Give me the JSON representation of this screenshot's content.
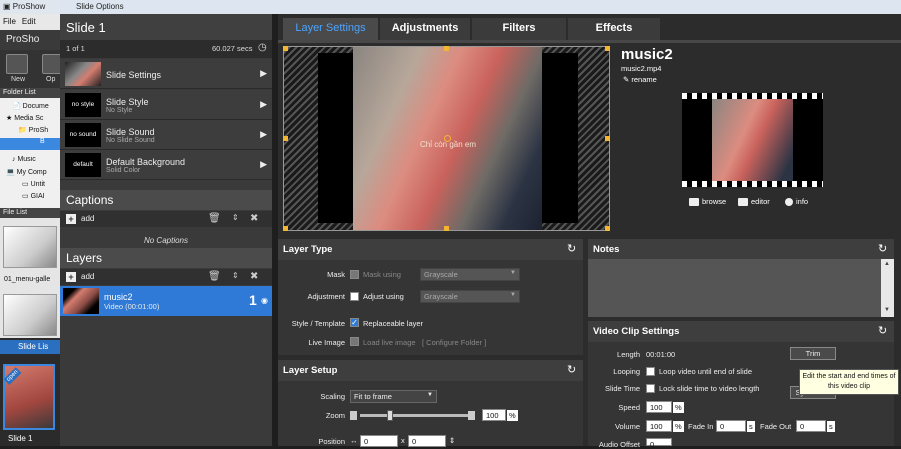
{
  "bgapp": {
    "title": "ProShow",
    "menu": [
      "File",
      "Edit"
    ],
    "brand": "ProSho",
    "tools": [
      {
        "label": "New"
      },
      {
        "label": "Op"
      }
    ],
    "folder_header": "Folder List",
    "tree": [
      "Docume",
      "Media Sc",
      "ProSh",
      "B",
      "Music",
      "My Comp",
      "Untit",
      "GIAI"
    ],
    "file_header": "File List",
    "file_item": "01_menu-galle",
    "slide_list_label": "Slide Lis",
    "open_badge": "open",
    "slide_label": "Slide 1"
  },
  "dialog": {
    "title": "Slide Options"
  },
  "left": {
    "slide_title": "Slide 1",
    "slide_index": "1 of 1",
    "duration": "60.027 secs",
    "rows": [
      {
        "thumb": "",
        "title": "Slide Settings",
        "sub": ""
      },
      {
        "thumb": "no style",
        "title": "Slide Style",
        "sub": "No Style"
      },
      {
        "thumb": "no sound",
        "title": "Slide Sound",
        "sub": "No Slide Sound"
      },
      {
        "thumb": "default",
        "title": "Default Background",
        "sub": "Solid Color"
      }
    ],
    "captions_header": "Captions",
    "add_label": "add",
    "no_captions": "No Captions",
    "layers_header": "Layers",
    "layer": {
      "name": "music2",
      "sub": "Video (00:01:00)",
      "number": "1"
    }
  },
  "tabs": [
    {
      "label": "Layer Settings",
      "active": true
    },
    {
      "label": "Adjustments",
      "active": false
    },
    {
      "label": "Filters",
      "active": false
    },
    {
      "label": "Effects",
      "active": false
    }
  ],
  "preview": {
    "watermark": "Chỉ còn gần em"
  },
  "right": {
    "title": "music2",
    "filename": "music2.mp4",
    "rename": "rename",
    "browse": "browse",
    "editor": "editor",
    "info": "info"
  },
  "layer_type": {
    "header": "Layer Type",
    "mask_label": "Mask",
    "mask_using": "Mask using",
    "mask_select": "Grayscale",
    "adj_label": "Adjustment",
    "adj_using": "Adjust using",
    "adj_select": "Grayscale",
    "style_label": "Style / Template",
    "replaceable": "Replaceable layer",
    "live_label": "Live Image",
    "load_live": "Load live image",
    "configure": "[ Configure Folder ]"
  },
  "layer_setup": {
    "header": "Layer Setup",
    "scaling_label": "Scaling",
    "scaling_value": "Fit to frame",
    "zoom_label": "Zoom",
    "zoom_value": "100",
    "zoom_unit": "%",
    "zoom_level": 0.28,
    "position_label": "Position",
    "pos_x": "0",
    "pos_x_sep": "x",
    "pos_y": "0"
  },
  "notes": {
    "header": "Notes"
  },
  "video": {
    "header": "Video Clip Settings",
    "length_label": "Length",
    "length_value": "00:01:00",
    "trim": "Trim",
    "looping_label": "Looping",
    "looping_text": "Loop video until end of slide",
    "slidetime_label": "Slide Time",
    "slidetime_text": "Lock slide time to video length",
    "sync": "Sync Time",
    "speed_label": "Speed",
    "speed_value": "100",
    "speed_unit": "%",
    "volume_label": "Volume",
    "volume_value": "100",
    "volume_unit": "%",
    "fadein_label": "Fade In",
    "fadein_value": "0",
    "fadeout_label": "Fade Out",
    "fadeout_value": "0",
    "s_unit": "s",
    "audio_offset_label": "Audio Offset",
    "audio_offset_value": "0",
    "tooltip": "Edit the start and end times of this video clip"
  },
  "colors": {
    "accent": "#2e7ad6",
    "handle": "#f2b632"
  }
}
